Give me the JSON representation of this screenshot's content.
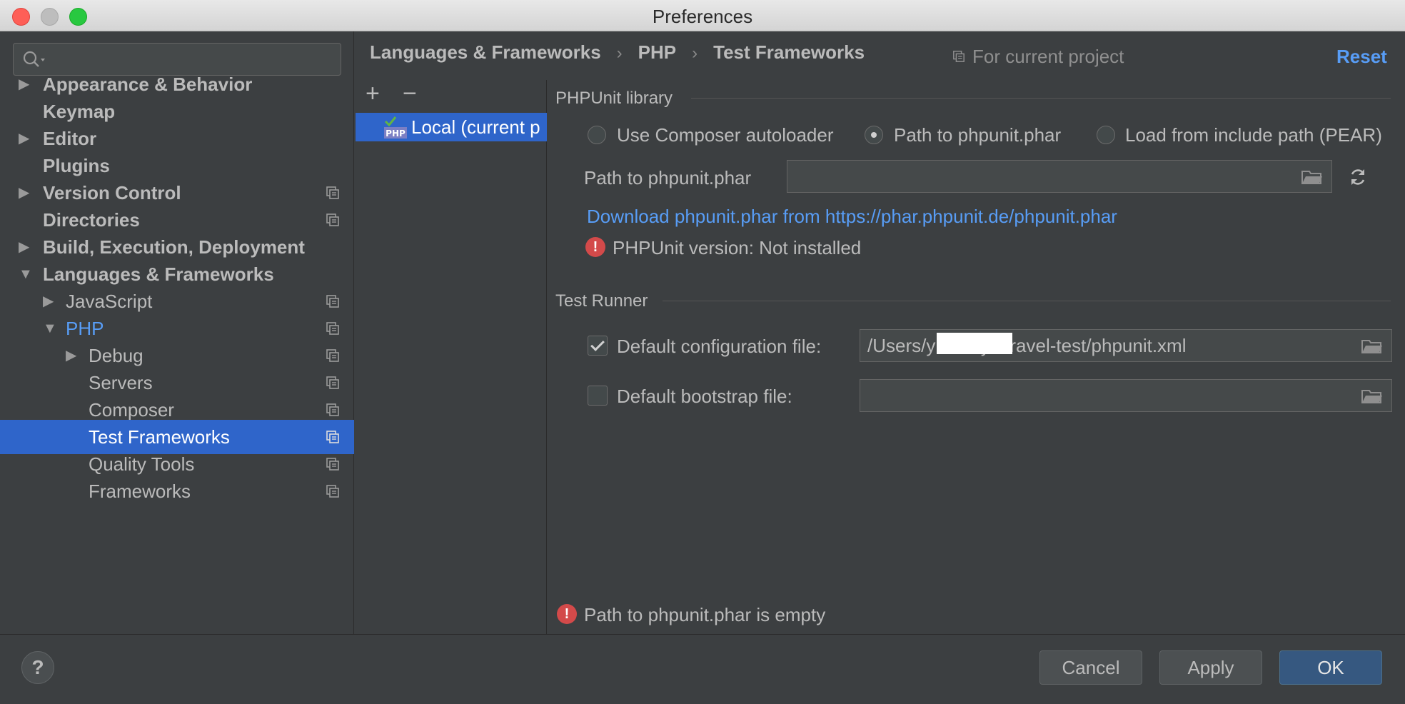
{
  "window": {
    "title": "Preferences"
  },
  "search": {
    "placeholder": ""
  },
  "sidebar": {
    "items": [
      {
        "label": "Appearance & Behavior"
      },
      {
        "label": "Keymap"
      },
      {
        "label": "Editor"
      },
      {
        "label": "Plugins"
      },
      {
        "label": "Version Control"
      },
      {
        "label": "Directories"
      },
      {
        "label": "Build, Execution, Deployment"
      },
      {
        "label": "Languages & Frameworks"
      },
      {
        "label": "JavaScript"
      },
      {
        "label": "PHP"
      },
      {
        "label": "Debug"
      },
      {
        "label": "Servers"
      },
      {
        "label": "Composer"
      },
      {
        "label": "Test Frameworks"
      },
      {
        "label": "Quality Tools"
      },
      {
        "label": "Frameworks"
      }
    ],
    "selected": "Test Frameworks"
  },
  "header": {
    "breadcrumb": [
      "Languages & Frameworks",
      "PHP",
      "Test Frameworks"
    ],
    "separator": "›",
    "for_current_project": "For current project",
    "reset": "Reset"
  },
  "list": {
    "add": "+",
    "remove": "−",
    "items": [
      {
        "label": "Local (current p"
      }
    ]
  },
  "phpunit": {
    "group_title": "PHPUnit library",
    "options": [
      {
        "label": "Use Composer autoloader",
        "checked": false
      },
      {
        "label": "Path to phpunit.phar",
        "checked": true
      },
      {
        "label": "Load from include path (PEAR)",
        "checked": false
      }
    ],
    "path_label": "Path to phpunit.phar",
    "path_value": "",
    "download_link": "Download phpunit.phar from https://phar.phpunit.de/phpunit.phar",
    "version_text": "PHPUnit version: Not installed"
  },
  "test_runner": {
    "group_title": "Test Runner",
    "config_label": "Default configuration file:",
    "config_checked": true,
    "config_value": "/Users/y           /study/laravel-test/phpunit.xml",
    "bootstrap_label": "Default bootstrap file:",
    "bootstrap_checked": false,
    "bootstrap_value": ""
  },
  "status": {
    "error": "Path to phpunit.phar is empty"
  },
  "footer": {
    "help": "?",
    "cancel": "Cancel",
    "apply": "Apply",
    "ok": "OK"
  },
  "colors": {
    "accent": "#2f65ca",
    "link": "#589df6",
    "error": "#d34a4a",
    "background": "#3c3f41"
  }
}
